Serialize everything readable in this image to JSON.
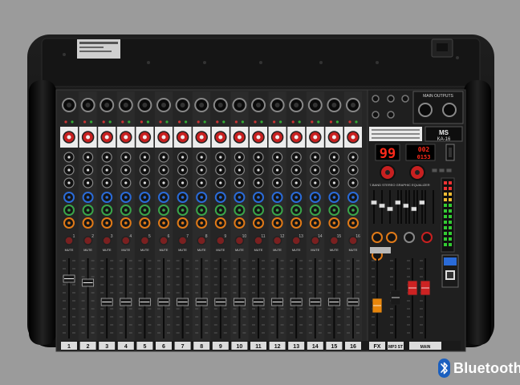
{
  "mixer": {
    "brand": "MS",
    "model": "KA-16",
    "main_outputs_label": "MAIN OUTPUTS",
    "eq_label": "7-BAND STEREO GRAPHIC EQUALIZER",
    "fx_display": "99",
    "mp3_display": "002",
    "mp3_time": "0153",
    "mute_label": "MUTE",
    "channel_labels": [
      "1",
      "2",
      "3",
      "4",
      "5",
      "6",
      "7",
      "8",
      "9",
      "10",
      "11",
      "12",
      "13",
      "14",
      "15",
      "16"
    ],
    "bottom_labels": [
      "FX",
      "MP3 ST",
      "MAIN"
    ],
    "colors": {
      "body": "#111111",
      "panel": "#2a2a2a",
      "fader_red": "#cc2222",
      "fader_orange": "#e8860c",
      "led_red": "#ff2a1a",
      "knob_blue": "#2a6bd8",
      "knob_green": "#3aa54a",
      "knob_orange": "#e07a18",
      "knob_red": "#c82020"
    }
  },
  "badge": {
    "label": "Bluetooth",
    "icon": "bluetooth-icon"
  }
}
